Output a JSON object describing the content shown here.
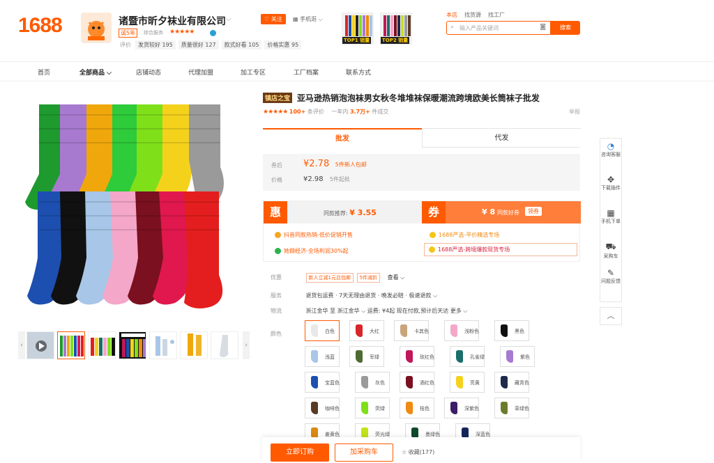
{
  "header": {
    "logo": "1688",
    "shop_name": "诸暨市昕夕袜业有限公司",
    "shop_caret": "⌵",
    "badge_years": "诚5年",
    "badge_company": "综合服务",
    "stars": "★★★★★",
    "scores_label": "评价",
    "scores": [
      "发货较好 195",
      "质量很好 127",
      "款式好看 105",
      "价格实惠 95"
    ],
    "follow": "♡ 关注",
    "mobile_shop": "▦ 手机逛 ⌵",
    "top_products": [
      "TOP1 销量",
      "TOP2 销量"
    ],
    "search_tabs": [
      "本店",
      "找货源",
      "找工厂"
    ],
    "search_placeholder": "输入产品关键词",
    "search_button": "搜索"
  },
  "nav": [
    "首页",
    "全部商品 ⌵",
    "店铺动态",
    "代理加盟",
    "加工专区",
    "工厂档案",
    "联系方式"
  ],
  "product": {
    "title_badge": "镇店之宝",
    "title": "亚马逊热销泡泡袜男女秋冬堆堆袜保暖潮流跨境欧美长筒袜子批发",
    "stars": "★★★★★",
    "reviews": "100+",
    "reviews_label": "条评价",
    "year_label": "一年内",
    "sold": "3.7万+",
    "sold_label": "件成交",
    "report": "举报"
  },
  "tabs": [
    "批发",
    "代发"
  ],
  "prices": {
    "after_label": "券后",
    "after_value": "¥2.78",
    "after_note": "5件新人包邮",
    "price_label": "价格",
    "price_value": "¥2.98",
    "price_note": "5件起批"
  },
  "promo": {
    "hui": "惠",
    "same_label": "同款推荐:",
    "same_value": "¥ 3.55",
    "quan": "券",
    "coupon_value": "¥ 8",
    "coupon_label": "同款好券",
    "coupon_btn": "领券",
    "items": [
      "抖音同款热销-低价促销开售",
      "1688严选-平价精选专场",
      "她撷经济-全场利润30%起",
      "1688严选-跨境爆款现货专场"
    ]
  },
  "attrs": {
    "offer_label": "优惠",
    "offer_chips": [
      "新人立减1元且包邮",
      "5件减折"
    ],
    "offer_more": "查看 ⌵",
    "service_label": "服务",
    "service_value": "退货包运费 · 7天无理由退货 · 晚发必赔 · 极速退款 ⌵",
    "logistics_label": "物流",
    "logistics_value": "浙江金华 至 浙江金华 ⌵  运费: ¥4起  现在付款,预计后天达  更多 ⌵",
    "color_label": "颜色"
  },
  "colors": [
    {
      "name": "白色",
      "hex": "#e8e8e8"
    },
    {
      "name": "大红",
      "hex": "#d8262b"
    },
    {
      "name": "卡其色",
      "hex": "#c9a57a"
    },
    {
      "name": "浅粉色",
      "hex": "#f4a7c8"
    },
    {
      "name": "黑色",
      "hex": "#111111"
    },
    {
      "name": "浅蓝",
      "hex": "#a8c6e8"
    },
    {
      "name": "军绿",
      "hex": "#4f6b34"
    },
    {
      "name": "玫红色",
      "hex": "#c0185a"
    },
    {
      "name": "孔雀绿",
      "hex": "#1a6e6a"
    },
    {
      "name": "紫色",
      "hex": "#a77ad0"
    },
    {
      "name": "宝蓝色",
      "hex": "#1d4fb0"
    },
    {
      "name": "灰色",
      "hex": "#9a9a9a"
    },
    {
      "name": "酒红色",
      "hex": "#7a1020"
    },
    {
      "name": "亮黄",
      "hex": "#f4d21c"
    },
    {
      "name": "藏青色",
      "hex": "#1e2a4a"
    },
    {
      "name": "咖啡色",
      "hex": "#5a3a22"
    },
    {
      "name": "荧绿",
      "hex": "#7fe01a"
    },
    {
      "name": "桔色",
      "hex": "#f08a10"
    },
    {
      "name": "深紫色",
      "hex": "#3c1f66"
    },
    {
      "name": "草绿色",
      "hex": "#6a7c2c"
    },
    {
      "name": "姜黄色",
      "hex": "#d98a10"
    },
    {
      "name": "荧光绿",
      "hex": "#c4e21a"
    },
    {
      "name": "墨绿色",
      "hex": "#0f4a2c"
    },
    {
      "name": "深蓝色",
      "hex": "#14265a"
    }
  ],
  "bottom": {
    "buy": "立即订购",
    "cart": "加采购车",
    "fav": "☆ 收藏(177)"
  },
  "side_tools": [
    "咨询客服",
    "下载插件",
    "手机下单",
    "采购车",
    "问题反馈"
  ]
}
